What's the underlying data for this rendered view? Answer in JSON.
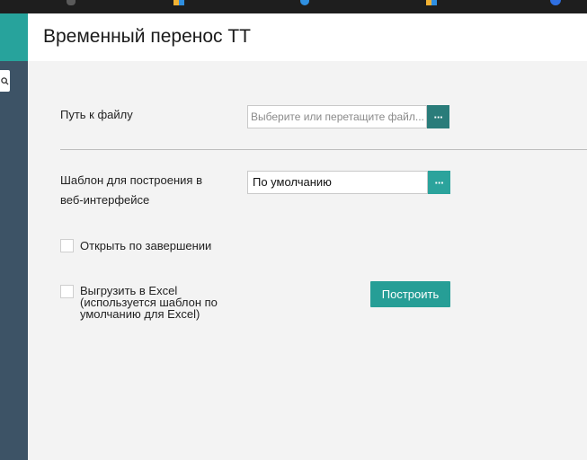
{
  "page": {
    "title": "Временный перенос ТТ"
  },
  "form": {
    "file_path": {
      "label": "Путь к файлу",
      "placeholder": "Выберите или перетащите файл..."
    },
    "template": {
      "label_line1": "Шаблон для построения в",
      "label_line2": "веб-интерфейсе",
      "value": "По умолчанию"
    },
    "open_on_finish": {
      "label": "Открыть по завершении",
      "checked": false
    },
    "export_excel": {
      "label_line1": "Выгрузить в Excel",
      "label_line2": "(используется шаблон по",
      "label_line3": "умолчанию для Excel)",
      "checked": false
    },
    "browse_button_label": "···",
    "build_button_label": "Построить"
  },
  "colors": {
    "sidebar": "#3d5366",
    "sidebar_accent": "#27a39c",
    "button_teal": "#269e96",
    "button_dark_teal": "#2a7c7a",
    "background": "#f3f3f3"
  }
}
